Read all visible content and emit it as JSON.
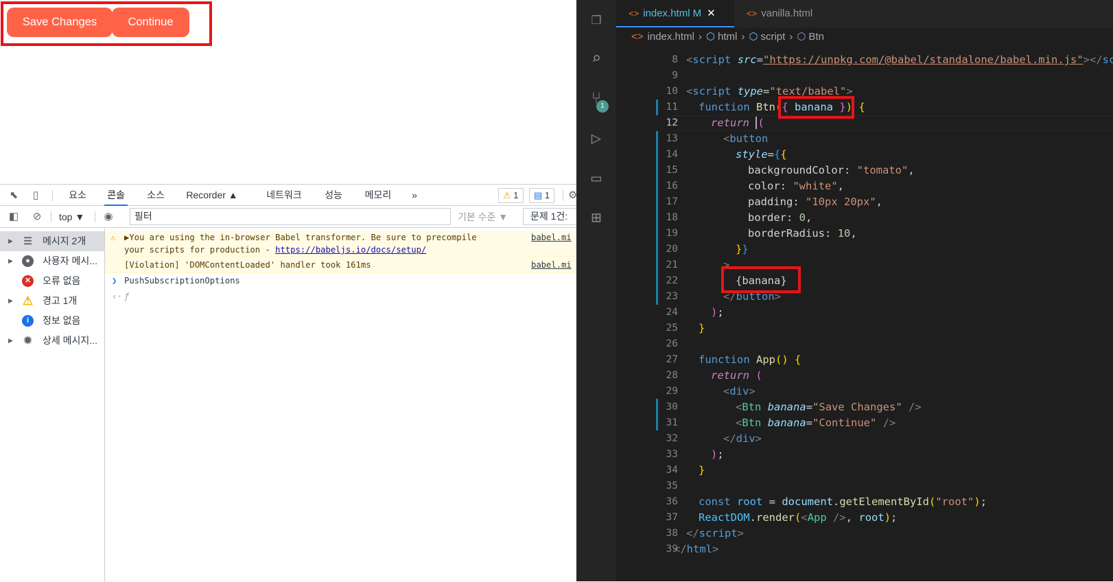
{
  "app_preview": {
    "buttons": [
      {
        "label": "Save Changes"
      },
      {
        "label": "Continue"
      }
    ],
    "button_color": "#ff6347"
  },
  "devtools": {
    "tabs": [
      "요소",
      "콘솔",
      "소스",
      "Recorder ▲",
      "네트워크",
      "성능",
      "메모리",
      "»"
    ],
    "active_tab": "콘솔",
    "warning_count": "1",
    "message_count": "1",
    "toolbar": {
      "context": "top ▼",
      "filter_placeholder": "필터",
      "level": "기본 수준 ▼",
      "issues": "문제 1건:"
    },
    "sidebar": [
      {
        "label": "메시지 2개",
        "icon": "list-icon"
      },
      {
        "label": "사용자 메시...",
        "icon": "user-icon"
      },
      {
        "label": "오류 없음",
        "icon": "error-icon"
      },
      {
        "label": "경고 1개",
        "icon": "warning-icon"
      },
      {
        "label": "정보 없음",
        "icon": "info-icon"
      },
      {
        "label": "상세 메시지...",
        "icon": "bug-icon"
      }
    ],
    "messages": [
      {
        "line1": "▶You are using the in-browser Babel transformer. Be sure to precompile",
        "line2_prefix": "your scripts for production - ",
        "link": "https://babeljs.io/docs/setup/",
        "source": "babel.mi"
      },
      {
        "text": "[Violation] 'DOMContentLoaded' handler took 161ms",
        "source": "babel.mi"
      },
      {
        "text": "PushSubscriptionOptions"
      },
      {
        "text": "ƒ"
      }
    ]
  },
  "vscode": {
    "tabs": [
      {
        "name": "index.html",
        "status": "M"
      },
      {
        "name": "vanilla.html"
      }
    ],
    "breadcrumbs": [
      "index.html",
      "html",
      "script",
      "Btn"
    ],
    "scm_badge": "1",
    "current_line": 12,
    "line_numbers": [
      "8",
      "9",
      "10",
      "11",
      "12",
      "13",
      "14",
      "15",
      "16",
      "17",
      "18",
      "19",
      "20",
      "21",
      "22",
      "23",
      "24",
      "25",
      "26",
      "27",
      "28",
      "29",
      "30",
      "31",
      "32",
      "33",
      "34",
      "35",
      "36",
      "37",
      "38",
      "39"
    ],
    "code": {
      "l8_src": "https://unpkg.com/@babel/standalone/babel.min.js",
      "l10_type": "\"text/babel\"",
      "l11_fn": "Btn",
      "l11_param": " banana ",
      "l15_prop": "backgroundColor",
      "l15_val": "\"tomato\"",
      "l16_prop": "color",
      "l16_val": "\"white\"",
      "l17_prop": "padding",
      "l17_val": "\"10px 20px\"",
      "l18_prop": "border",
      "l18_val": "0",
      "l19_prop": "borderRadius",
      "l19_val": "10",
      "l22_expr": "{banana}",
      "l27_fn": "App",
      "l30_val": "\"Save Changes\"",
      "l31_val": "\"Continue\"",
      "l36_method": "getElementById",
      "l36_arg": "\"root\""
    }
  }
}
